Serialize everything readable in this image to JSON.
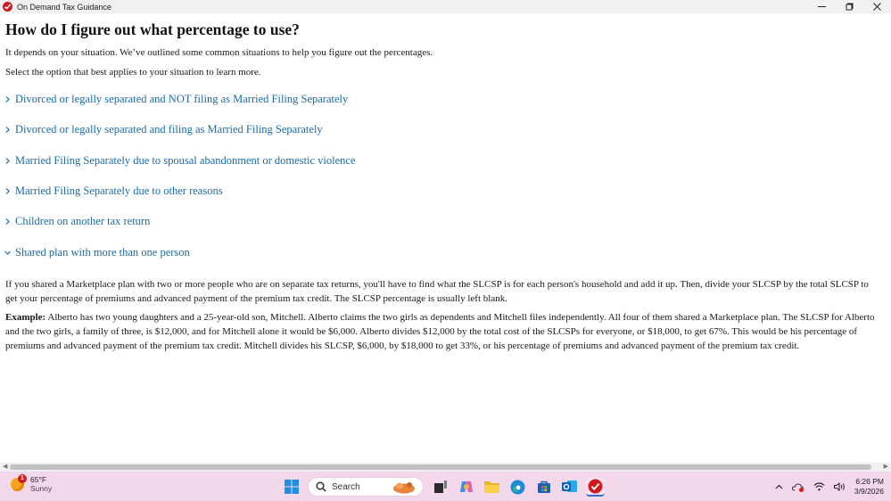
{
  "window": {
    "title": "On Demand Tax Guidance"
  },
  "page": {
    "heading": "How do I figure out what percentage to use?",
    "intro": "It depends on your situation. We’ve outlined some common situations to help you figure out the percentages.",
    "instruction": "Select the option that best applies to your situation to learn more."
  },
  "options": [
    {
      "label": "Divorced or legally separated and NOT filing as Married Filing Separately",
      "expanded": false
    },
    {
      "label": "Divorced or legally separated and filing as Married Filing Separately",
      "expanded": false
    },
    {
      "label": "Married Filing Separately due to spousal abandonment or domestic violence",
      "expanded": false
    },
    {
      "label": "Married Filing Separately due to other reasons",
      "expanded": false
    },
    {
      "label": "Children on another tax return",
      "expanded": false
    },
    {
      "label": "Shared plan with more than one person",
      "expanded": true
    }
  ],
  "expanded_content": {
    "paragraph": "If you shared a Marketplace plan with two or more people who are on separate tax returns, you'll have to find what the SLCSP is for each person's household and add it up. Then, divide your SLCSP by the total SLCSP to get your percentage of premiums and advanced payment of the premium tax credit. The SLCSP percentage is usually left blank.",
    "example_label": "Example:",
    "example_text": " Alberto has two young daughters and a 25-year-old son, Mitchell. Alberto claims the two girls as dependents and Mitchell files independently. All four of them shared a Marketplace plan. The SLCSP for Alberto and the two girls, a family of three, is $12,000, and for Mitchell alone it would be $6,000. Alberto divides $12,000 by the total cost of the SLCSPs for everyone, or $18,000, to get 67%. This would be his percentage of premiums and advanced payment of the premium tax credit. Mitchell divides his SLCSP, $6,000, by $18,000 to get 33%, or his percentage of premiums and advanced payment of the premium tax credit."
  },
  "taskbar": {
    "weather_temp": "65°F",
    "weather_desc": "Sunny",
    "weather_badge": "1",
    "search_placeholder": "Search",
    "time": "6:26 PM",
    "date": "3/9/2026"
  },
  "colors": {
    "link": "#1c6aa8",
    "taskbar_bg": "#f3d7ea",
    "brand_red": "#d0181f"
  }
}
